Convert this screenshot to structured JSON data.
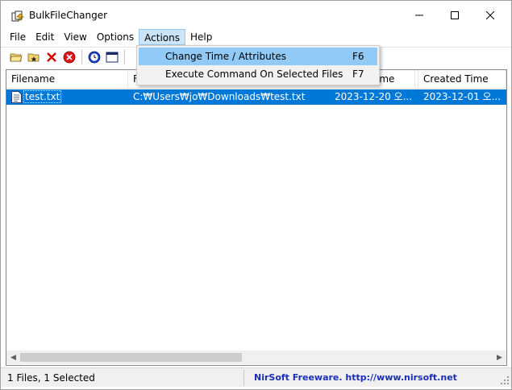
{
  "window": {
    "title": "BulkFileChanger"
  },
  "menu": [
    "File",
    "Edit",
    "View",
    "Options",
    "Actions",
    "Help"
  ],
  "toolbar_icons": [
    "open-folder-icon",
    "add-folder-icon",
    "remove-icon",
    "clear-all-icon",
    "change-time-icon",
    "properties-icon"
  ],
  "list": {
    "columns": [
      "Filename",
      "F",
      "ime",
      "Created Time"
    ],
    "rows": [
      {
        "filename": "test.txt",
        "path": "C:₩Users₩jo₩Downloads₩test.txt",
        "modified": "2023-12-20 오...",
        "created": "2023-12-01 오..."
      }
    ]
  },
  "dropdown": {
    "items": [
      {
        "label": "Change Time / Attributes",
        "shortcut": "F6"
      },
      {
        "label": "Execute Command On Selected Files",
        "shortcut": "F7"
      }
    ]
  },
  "status": {
    "left": "1 Files, 1 Selected",
    "right": "NirSoft Freeware.  http://www.nirsoft.net"
  },
  "colors": {
    "selection": "#0078d7",
    "menu_hover": "#91c9f7",
    "status_link": "#1a2fb5"
  }
}
